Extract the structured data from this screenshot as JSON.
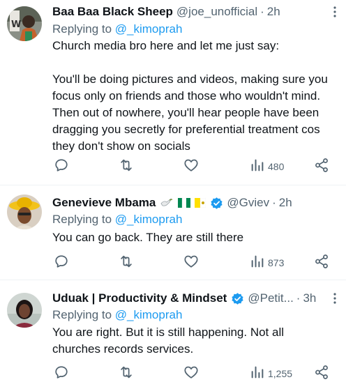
{
  "tweets": [
    {
      "name": "Baa Baa Black Sheep",
      "handle": "@joe_unofficial",
      "dot": "·",
      "time": "2h",
      "replying_prefix": "Replying to ",
      "replying_to": "@_kimoprah",
      "text": "Church media bro here and let me just say:\n\nYou'll be doing pictures and videos, making sure you focus only on friends and those who wouldn't mind. Then out of nowhere, you'll hear people have been dragging you secretly for preferential treatment cos they don't show on socials",
      "views": "480",
      "verified": false,
      "icons": {
        "reply": "comment-icon",
        "retweet": "retweet-icon",
        "like": "heart-icon",
        "views": "bar-chart-icon",
        "share": "share-icon",
        "more": "more-dots-icon"
      }
    },
    {
      "name": "Genevieve Mbama",
      "handle": "@Gviev",
      "dot": "·",
      "time": "2h",
      "replying_prefix": "Replying to ",
      "replying_to": "@_kimoprah",
      "text": "You can go back. They are still there",
      "views": "873",
      "verified": true,
      "name_emojis": [
        "dove-emoji",
        "nigeria-flag-emoji",
        "vatican-flag-emoji"
      ]
    },
    {
      "name": "Uduak | Productivity & Mindset",
      "handle": "@Petit...",
      "dot": "·",
      "time": "3h",
      "replying_prefix": "Replying to ",
      "replying_to": "@_kimoprah",
      "text": "You are right. But it is still happening. Not all churches records services.",
      "views": "1,255",
      "verified": true
    }
  ],
  "colors": {
    "text": "#0f1419",
    "secondary": "#536471",
    "link": "#1d9bf0",
    "divider": "#eff3f4",
    "verified": "#1d9bf0"
  }
}
